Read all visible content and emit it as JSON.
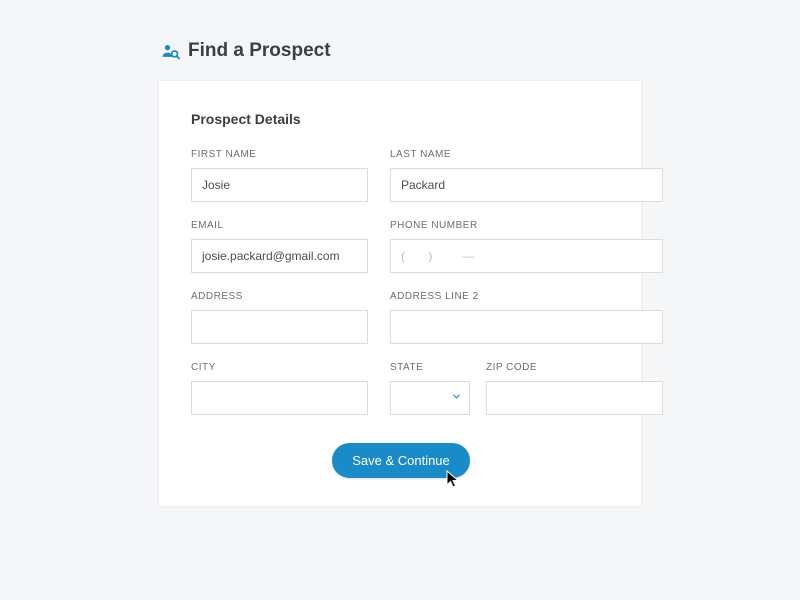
{
  "header": {
    "title": "Find a Prospect"
  },
  "card": {
    "section_title": "Prospect Details",
    "fields": {
      "first_name": {
        "label": "FIRST NAME",
        "value": "Josie"
      },
      "last_name": {
        "label": "LAST NAME",
        "value": "Packard"
      },
      "email": {
        "label": "EMAIL",
        "value": "josie.packard@gmail.com"
      },
      "phone": {
        "label": "PHONE NUMBER",
        "placeholder": "(       )         —"
      },
      "address": {
        "label": "ADDRESS",
        "value": ""
      },
      "address2": {
        "label": "ADDRESS LINE 2",
        "value": ""
      },
      "city": {
        "label": "CITY",
        "value": ""
      },
      "state": {
        "label": "STATE",
        "value": ""
      },
      "zip": {
        "label": "ZIP CODE",
        "value": ""
      }
    },
    "button": {
      "label": "Save & Continue"
    }
  },
  "colors": {
    "accent": "#1a8bc9"
  }
}
